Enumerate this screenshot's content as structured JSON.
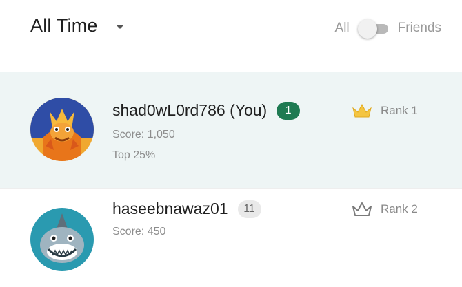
{
  "header": {
    "period_label": "All Time",
    "filter": {
      "left_label": "All",
      "right_label": "Friends",
      "selected": "All"
    }
  },
  "entries": [
    {
      "username": "shad0wL0rd786 (You)",
      "level": "1",
      "score": "Score: 1,050",
      "percentile": "Top 25%",
      "rank": "Rank 1",
      "rank_icon": "crown-gold-icon",
      "avatar_icon": "dragon-avatar-icon",
      "highlighted": true
    },
    {
      "username": "haseebnawaz01",
      "level": "11",
      "score": "Score: 450",
      "rank": "Rank 2",
      "rank_icon": "crown-gray-icon",
      "avatar_icon": "shark-avatar-icon",
      "highlighted": false
    }
  ],
  "colors": {
    "highlight_row": "#eef5f5",
    "level_badge_self": "#1e7a52",
    "level_badge_other": "#e9e9e9",
    "crown_gold": "#f4c542",
    "crown_gray": "#7a7a7a"
  }
}
